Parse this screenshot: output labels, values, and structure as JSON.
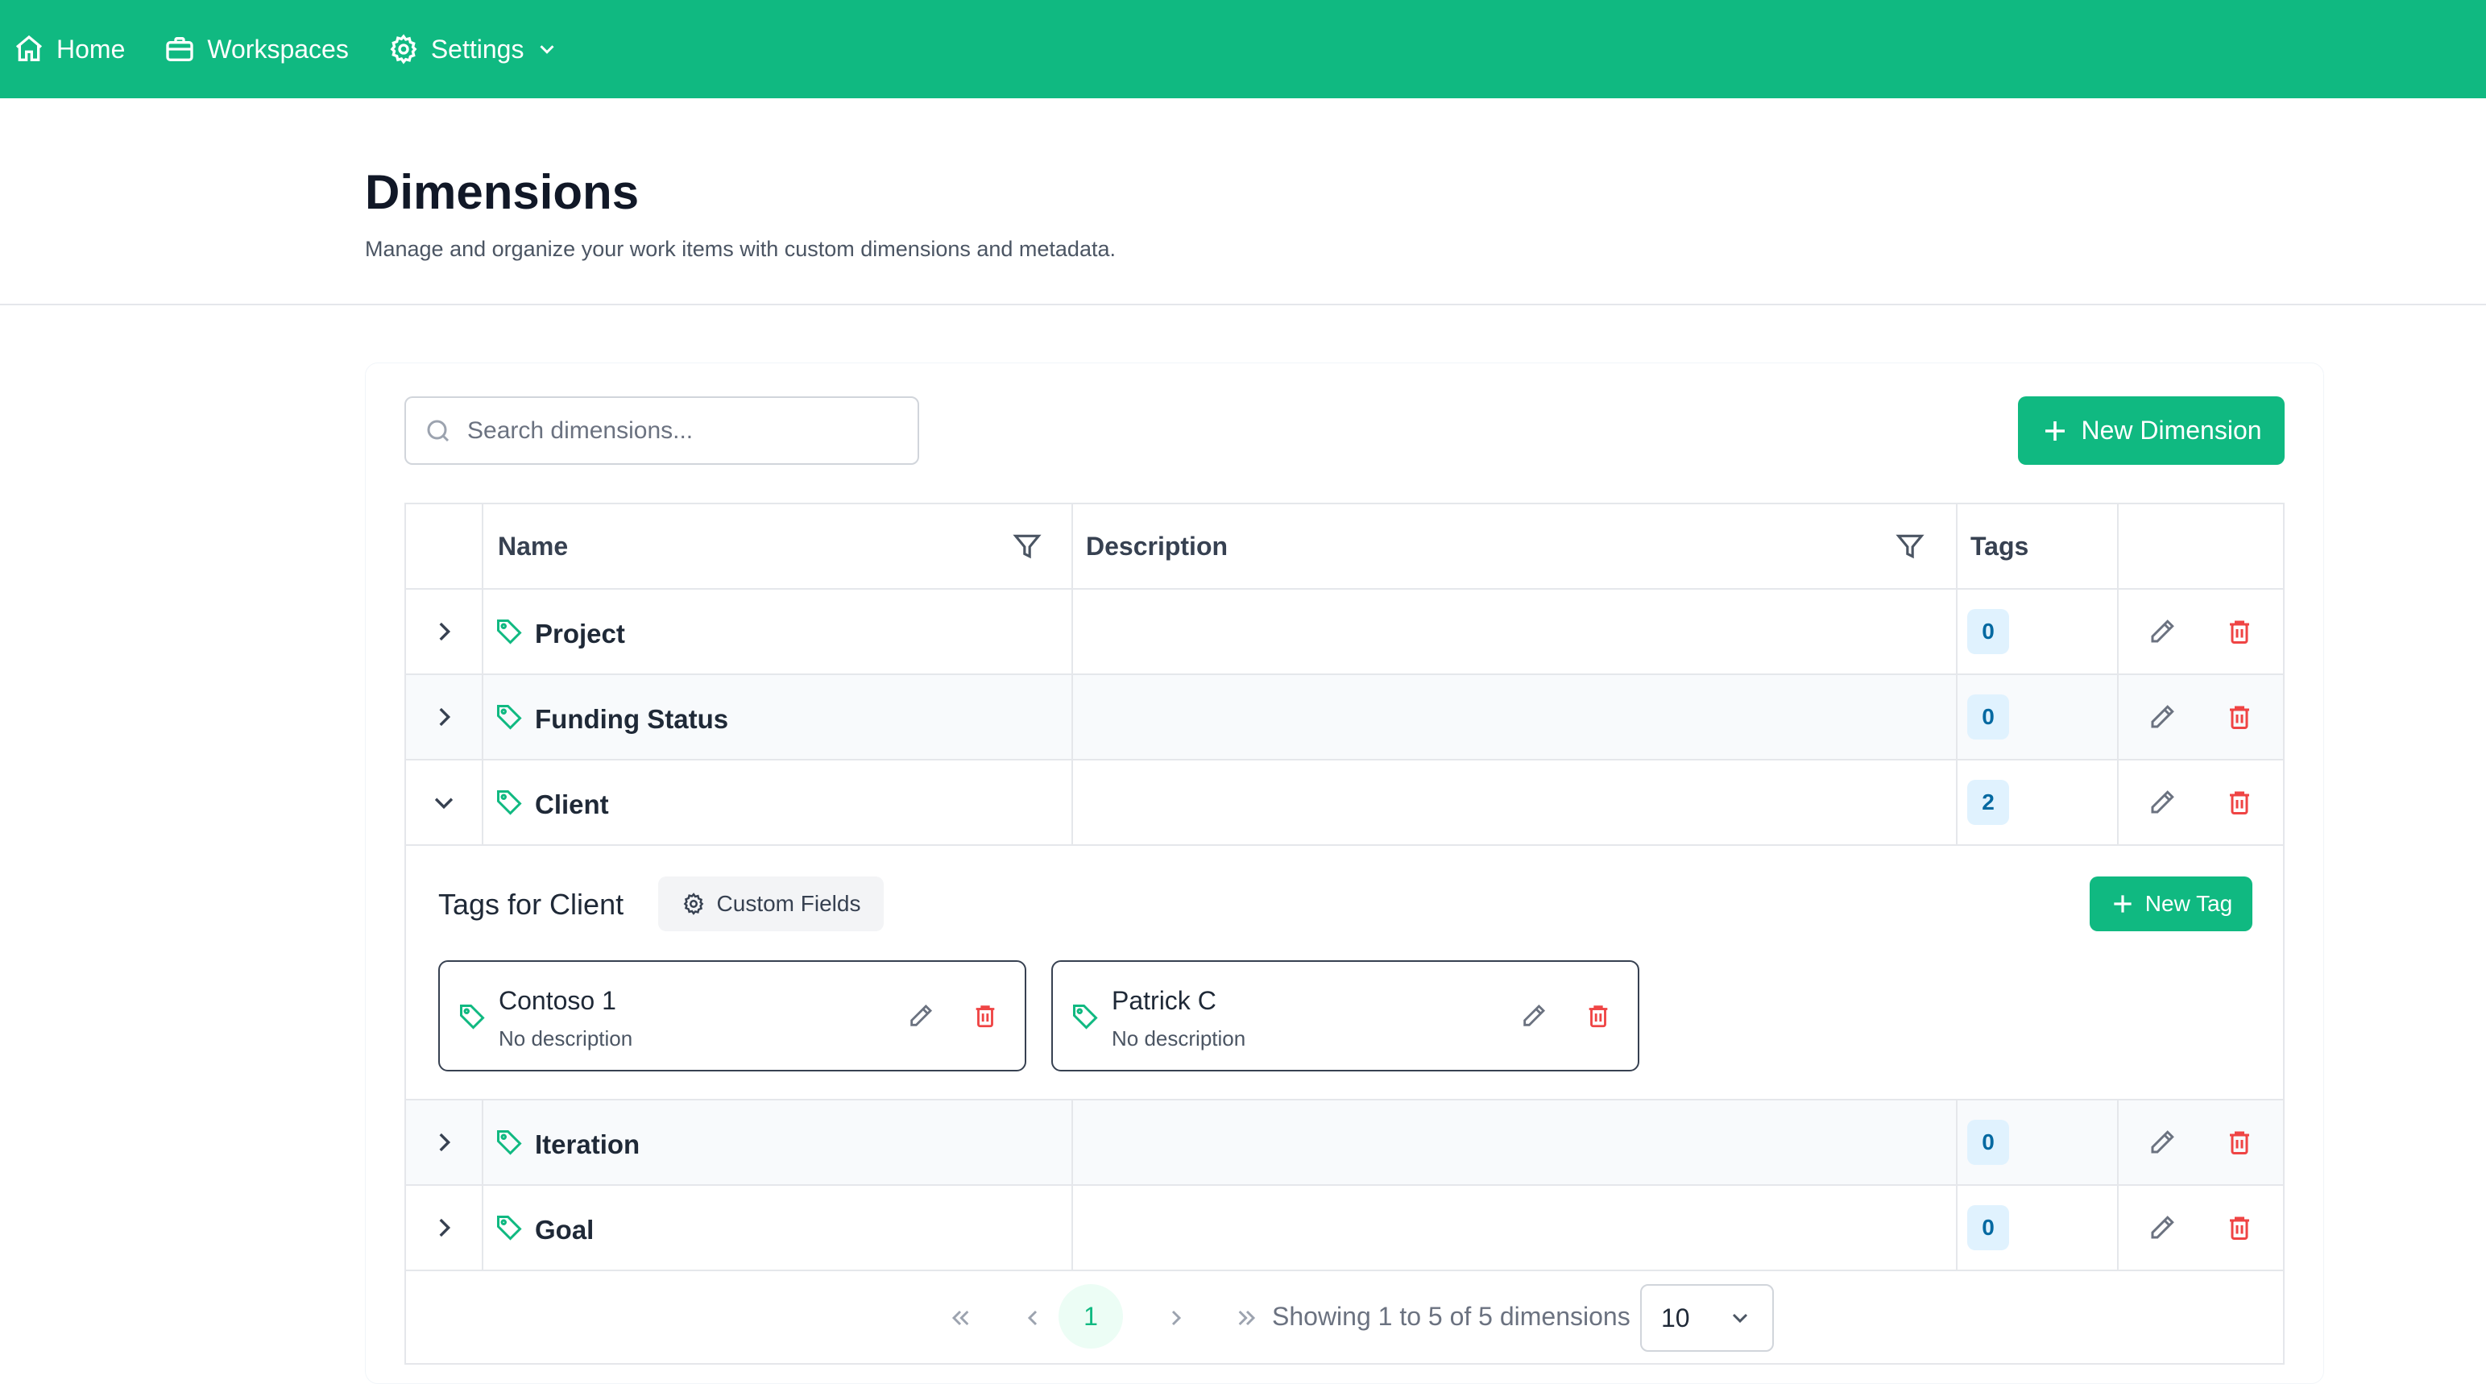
{
  "nav": {
    "home": "Home",
    "workspaces": "Workspaces",
    "settings": "Settings"
  },
  "header": {
    "title": "Dimensions",
    "subtitle": "Manage and organize your work items with custom dimensions and metadata."
  },
  "toolbar": {
    "search_placeholder": "Search dimensions...",
    "new_dimension": "New Dimension"
  },
  "table": {
    "columns": {
      "name": "Name",
      "description": "Description",
      "tags": "Tags"
    },
    "rows": [
      {
        "name": "Project",
        "description": "",
        "tags": "0",
        "expanded": false
      },
      {
        "name": "Funding Status",
        "description": "",
        "tags": "0",
        "expanded": false
      },
      {
        "name": "Client",
        "description": "",
        "tags": "2",
        "expanded": true
      },
      {
        "name": "Iteration",
        "description": "",
        "tags": "0",
        "expanded": false
      },
      {
        "name": "Goal",
        "description": "",
        "tags": "0",
        "expanded": false
      }
    ]
  },
  "expanded": {
    "title": "Tags for Client",
    "custom_fields": "Custom Fields",
    "new_tag": "New Tag",
    "tags": [
      {
        "name": "Contoso 1",
        "description": "No description"
      },
      {
        "name": "Patrick C",
        "description": "No description"
      }
    ]
  },
  "pagination": {
    "current_page": "1",
    "info": "Showing 1 to 5 of 5 dimensions",
    "page_size": "10"
  },
  "colors": {
    "brand": "#10b981",
    "danger": "#ef4444",
    "badge_bg": "#e0f2fe",
    "badge_text": "#0369a1"
  }
}
